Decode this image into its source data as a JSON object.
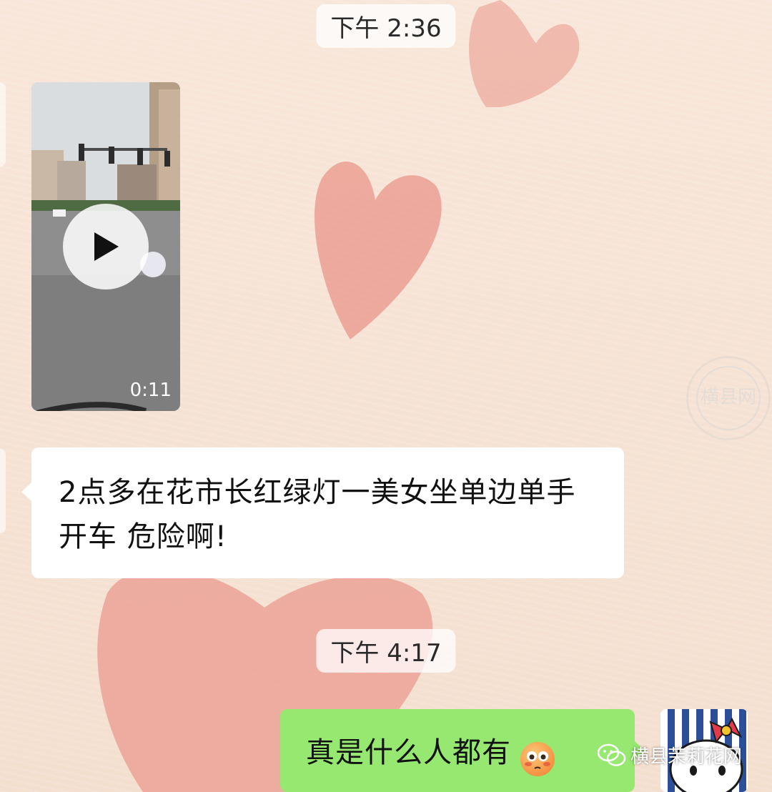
{
  "chat": {
    "timestamp_1": "下午 2:36",
    "timestamp_2": "下午 4:17",
    "video_message": {
      "duration": "0:11"
    },
    "incoming_message": "2点多在花市长红绿灯一美女坐单边单手开车 危险啊!",
    "outgoing_message": "真是什么人都有",
    "outgoing_emoji": "flushed-face-emoji"
  },
  "watermark": {
    "text": "横县茉莉花网",
    "icon": "wechat-icon",
    "stamp_text": "横县网"
  },
  "colors": {
    "background": "#f6e3d5",
    "heart": "#e9958a",
    "incoming_bubble": "#ffffff",
    "outgoing_bubble": "#96e871"
  }
}
